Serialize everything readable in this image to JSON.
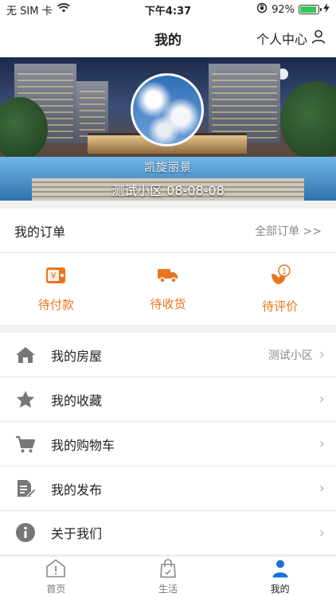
{
  "status_bar": {
    "carrier": "无 SIM 卡",
    "time": "下午4:37",
    "battery": "92%",
    "battery_level": 0.92
  },
  "nav": {
    "title": "我的",
    "right_label": "个人中心"
  },
  "profile": {
    "name": "凯旋丽景",
    "community_tag": "测试小区 08-08-08"
  },
  "orders": {
    "title": "我的订单",
    "all_label": "全部订单 >>",
    "items": [
      {
        "label": "待付款",
        "icon": "wallet-icon"
      },
      {
        "label": "待收货",
        "icon": "truck-icon"
      },
      {
        "label": "待评价",
        "icon": "review-icon",
        "badge": "1"
      }
    ]
  },
  "menu": {
    "items": [
      {
        "label": "我的房屋",
        "value": "测试小区",
        "icon": "house-icon"
      },
      {
        "label": "我的收藏",
        "icon": "star-icon"
      },
      {
        "label": "我的购物车",
        "icon": "cart-icon"
      },
      {
        "label": "我的发布",
        "icon": "publish-icon"
      },
      {
        "label": "关于我们",
        "icon": "info-icon"
      }
    ]
  },
  "tabs": [
    {
      "label": "首页",
      "icon": "home-icon"
    },
    {
      "label": "生活",
      "icon": "bag-icon"
    },
    {
      "label": "我的",
      "icon": "person-icon",
      "active": true
    }
  ],
  "colors": {
    "accent": "#e8761f",
    "active_tab": "#1a6fd6",
    "battery": "#34c759"
  }
}
